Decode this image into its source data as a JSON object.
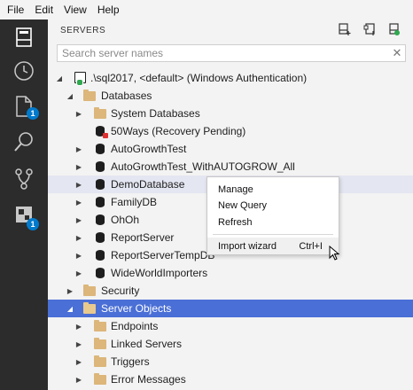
{
  "menubar": {
    "items": [
      "File",
      "Edit",
      "View",
      "Help"
    ]
  },
  "activitybar": {
    "badges": {
      "explorer": "1",
      "extensions": "1"
    }
  },
  "panel": {
    "title": "SERVERS",
    "search_placeholder": "Search server names"
  },
  "tree": {
    "server": ".\\sql2017, <default> (Windows Authentication)",
    "databases": "Databases",
    "system_databases": "System Databases",
    "db_50ways": "50Ways (Recovery Pending)",
    "db_autogrowthtest": "AutoGrowthTest",
    "db_autogrowthtest_all": "AutoGrowthTest_WithAUTOGROW_All",
    "db_demo": "DemoDatabase",
    "db_family": "FamilyDB",
    "db_ohoh": "OhOh",
    "db_reportserver": "ReportServer",
    "db_reportservertemp": "ReportServerTempDB",
    "db_wwi": "WideWorldImporters",
    "security": "Security",
    "server_objects": "Server Objects",
    "endpoints": "Endpoints",
    "linked_servers": "Linked Servers",
    "triggers": "Triggers",
    "error_messages": "Error Messages"
  },
  "context_menu": {
    "manage": "Manage",
    "new_query": "New Query",
    "refresh": "Refresh",
    "import_wizard": "Import wizard",
    "import_shortcut": "Ctrl+I"
  },
  "colors": {
    "activitybar": "#2c2c2c",
    "panel": "#f3f3f3",
    "selection": "#4a6fd6",
    "hover": "#e4e6f1",
    "badge": "#007acc",
    "folder": "#dcb67a"
  }
}
